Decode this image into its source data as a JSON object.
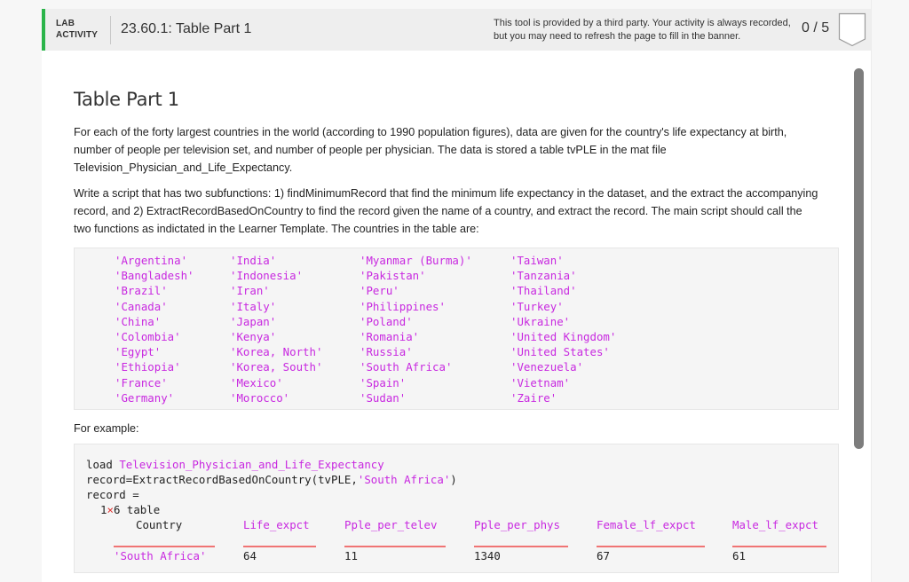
{
  "banner": {
    "lab_label_line1": "LAB",
    "lab_label_line2": "ACTIVITY",
    "activity_title": "23.60.1: Table Part 1",
    "notice_line1": "This tool is provided by a third party. Your activity is always recorded,",
    "notice_line2": "but you may need to refresh the page to fill in the banner.",
    "score": "0 / 5",
    "accent_color": "#2bb44a"
  },
  "content": {
    "heading": "Table Part 1",
    "paragraph1": "For each of the forty largest countries in the world (according to 1990 population figures), data are given for the country's life expectancy at birth, number of people per television set, and number of people per physician.  The data is stored a table tvPLE in the mat  file Television_Physician_and_Life_Expectancy.",
    "paragraph2": "Write a script that has two subfunctions: 1) findMinimumRecord that find the minimum life expectancy in the dataset, and the extract the accompanying record, and 2) ExtractRecordBasedOnCountry to find the record given the name of a country, and extract the record.  The main script should call the two functions as indictated in the Learner Template.  The countries in the table are:",
    "countries": [
      [
        "'Argentina'",
        "'Bangladesh'",
        "'Brazil'",
        "'Canada'",
        "'China'",
        "'Colombia'",
        "'Egypt'",
        "'Ethiopia'",
        "'France'",
        "'Germany'"
      ],
      [
        "'India'",
        "'Indonesia'",
        "'Iran'",
        "'Italy'",
        "'Japan'",
        "'Kenya'",
        "'Korea, North'",
        "'Korea, South'",
        "'Mexico'",
        "'Morocco'"
      ],
      [
        "'Myanmar (Burma)'",
        "'Pakistan'",
        "'Peru'",
        "'Philippines'",
        "'Poland'",
        "'Romania'",
        "'Russia'",
        "'South Africa'",
        "'Spain'",
        "'Sudan'"
      ],
      [
        "'Taiwan'",
        "'Tanzania'",
        "'Thailand'",
        "'Turkey'",
        "'Ukraine'",
        "'United Kingdom'",
        "'United States'",
        "'Venezuela'",
        "'Vietnam'",
        "'Zaire'"
      ]
    ],
    "example_label": "For example:",
    "example": {
      "line1_cmd": "load ",
      "line1_arg": "Television_Physician_and_Life_Expectancy",
      "line2_prefix": "record=ExtractRecordBasedOnCountry(tvPLE,",
      "line2_arg": "'South Africa'",
      "line2_suffix": ")",
      "line3": "record =",
      "size_rows": "1",
      "size_times": "×",
      "size_rest": "6 table",
      "table_headers": [
        "Country",
        "Life_expct",
        "Pple_per_telev",
        "Pple_per_phys",
        "Female_lf_expct",
        "Male_lf_expct"
      ],
      "table_row": [
        "'South Africa'",
        "64",
        "11",
        "1340",
        "67",
        "61"
      ]
    }
  }
}
